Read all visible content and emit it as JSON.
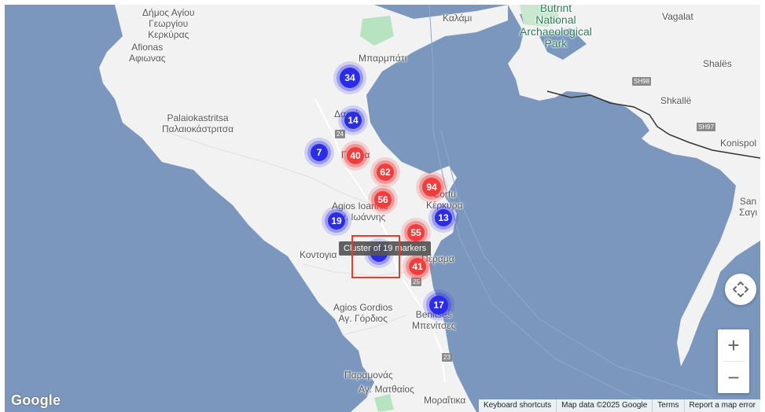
{
  "map": {
    "labels": {
      "dimos": "Δήμος Αγίου",
      "georgiou": "Γεωργίου",
      "kerkyras": "Κερκύρας",
      "afionas_lat": "Afionas",
      "afionas_gr": "Αφιωνας",
      "palaio_lat": "Palaiokastritsa",
      "palaio_gr": "Παλαιοκάστριτσα",
      "agios_ioannis_lat": "Agios Ioannis",
      "agios_ioannis_gr": "Αγ. Ιωάννης",
      "kontogia": "Κοντογια",
      "agios_gordios_lat": "Agios Gordios",
      "agios_gordios_gr": "Αγ. Γόρδιος",
      "paramonas": "Παραμονάς",
      "agios_matthaios": "Αγ. Ματθαίος",
      "moraitika": "Μοραΐτικα",
      "benitses_lat": "Benitses",
      "benitses_gr": "Μπενίτσες",
      "perama": "Πέραμα",
      "corfu_lat": "Corfu",
      "corfu_gr": "Κέρκυρα",
      "barbati": "Μπαρμπάτι",
      "kalami": "Καλάμι",
      "dassia": "Δασιά",
      "gouvia": "Γούβια",
      "butrint_1": "Butrint",
      "butrint_2": "National",
      "butrint_3": "Archaeological",
      "butrint_4": "Park",
      "vagalat": "Vagalat",
      "shales": "Shalës",
      "shkalle": "Shkallë",
      "konispol": "Konispol",
      "san": "San",
      "sagi": "Σαγι"
    },
    "shields": {
      "sh98": "SH98",
      "sh97": "SH97",
      "r24": "24",
      "r25": "25",
      "r23": "23"
    },
    "clusters": [
      {
        "count": "34",
        "color": "blue"
      },
      {
        "count": "14",
        "color": "blue"
      },
      {
        "count": "7",
        "color": "blue"
      },
      {
        "count": "40",
        "color": "red"
      },
      {
        "count": "62",
        "color": "red"
      },
      {
        "count": "56",
        "color": "red"
      },
      {
        "count": "94",
        "color": "red"
      },
      {
        "count": "13",
        "color": "blue"
      },
      {
        "count": "19",
        "color": "blue"
      },
      {
        "count": "55",
        "color": "red"
      },
      {
        "count": "",
        "color": "blue"
      },
      {
        "count": "41",
        "color": "red"
      },
      {
        "count": "17",
        "color": "blue"
      }
    ],
    "tooltip": "Cluster of 19 markers",
    "colors": {
      "water": "#7b97be",
      "land": "#f2f2f2",
      "cluster_blue": "#2b2bea",
      "cluster_red": "#f03e3e",
      "highlight": "#e53b2b"
    }
  },
  "controls": {
    "zoom_in": "+",
    "zoom_out": "−",
    "fullscreen_icon": "fullscreen-icon"
  },
  "attribution": {
    "logo": "Google",
    "keyboard": "Keyboard shortcuts",
    "mapdata": "Map data ©2025 Google",
    "terms": "Terms",
    "report": "Report a map error"
  }
}
